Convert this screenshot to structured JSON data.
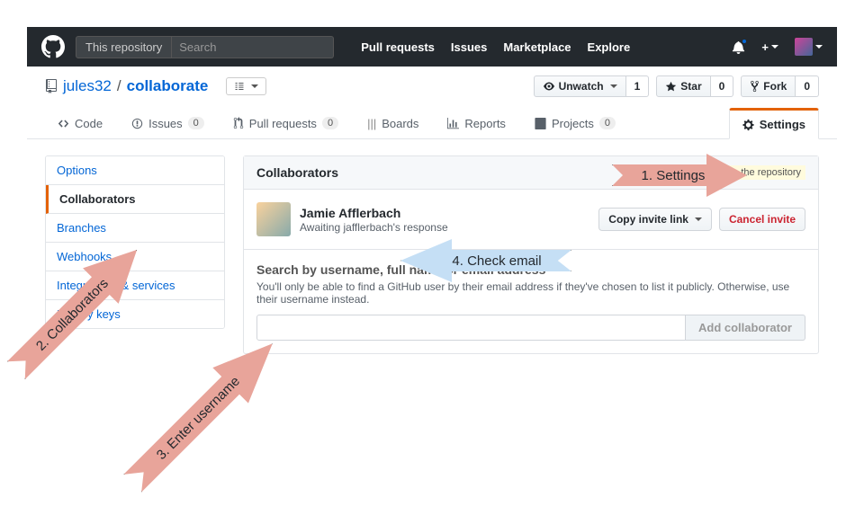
{
  "nav": {
    "scope": "This repository",
    "search_placeholder": "Search",
    "links": [
      "Pull requests",
      "Issues",
      "Marketplace",
      "Explore"
    ]
  },
  "repo": {
    "owner": "jules32",
    "name": "collaborate",
    "actions": {
      "watch_label": "Unwatch",
      "watch_count": "1",
      "star_label": "Star",
      "star_count": "0",
      "fork_label": "Fork",
      "fork_count": "0"
    },
    "tabs": {
      "code": "Code",
      "issues": "Issues",
      "issues_count": "0",
      "pulls": "Pull requests",
      "pulls_count": "0",
      "boards": "Boards",
      "reports": "Reports",
      "projects": "Projects",
      "projects_count": "0",
      "settings": "Settings"
    }
  },
  "side_menu": {
    "items": [
      "Options",
      "Collaborators",
      "Branches",
      "Webhooks",
      "Integrations & services",
      "Deploy keys"
    ],
    "selected": "Collaborators"
  },
  "collaborators": {
    "heading": "Collaborators",
    "push_note": "Push access to the repository",
    "pending": {
      "name": "Jamie Afflerbach",
      "status": "Awaiting jafflerbach's response",
      "copy_label": "Copy invite link",
      "cancel_label": "Cancel invite"
    },
    "search": {
      "heading": "Search by username, full name or email address",
      "help": "You'll only be able to find a GitHub user by their email address if they've chosen to list it publicly. Otherwise, use their username instead.",
      "button": "Add collaborator"
    }
  },
  "annotations": {
    "a1": "1. Settings",
    "a2": "2. Collaborators",
    "a3": "3. Enter username",
    "a4": "4. Check email"
  }
}
